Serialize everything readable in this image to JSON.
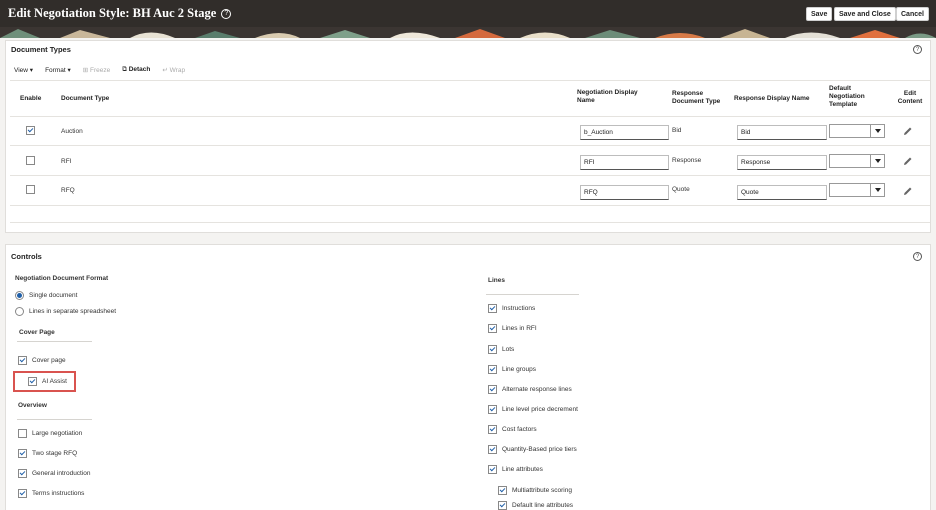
{
  "header": {
    "title": "Edit Negotiation Style: BH Auc 2 Stage",
    "help_icon": "?",
    "save": "Save",
    "save_close": "Save and Close",
    "cancel": "Cancel"
  },
  "doc_types": {
    "title": "Document Types",
    "toolbar": {
      "view": "View",
      "format": "Format",
      "freeze": "Freeze",
      "detach": "Detach",
      "wrap": "Wrap"
    },
    "headers": {
      "enable": "Enable",
      "doc_type": "Document Type",
      "neg_display": "Negotiation Display Name",
      "resp_doc_type": "Response Document Type",
      "resp_display": "Response Display Name",
      "default_template": "Default Negotiation Template",
      "edit_content": "Edit Content"
    },
    "rows": [
      {
        "enabled": true,
        "type": "Auction",
        "neg_name": "b_Auction",
        "resp_type": "Bid",
        "resp_name": "Bid"
      },
      {
        "enabled": false,
        "type": "RFI",
        "neg_name": "RFI",
        "resp_type": "Response",
        "resp_name": "Response"
      },
      {
        "enabled": false,
        "type": "RFQ",
        "neg_name": "RFQ",
        "resp_type": "Quote",
        "resp_name": "Quote"
      }
    ]
  },
  "controls": {
    "title": "Controls",
    "format_label": "Negotiation Document Format",
    "formats": [
      {
        "label": "Single document",
        "selected": true
      },
      {
        "label": "Lines in separate spreadsheet",
        "selected": false
      }
    ],
    "cover_label": "Cover Page",
    "cover_items": [
      {
        "label": "Cover page",
        "checked": true
      },
      {
        "label": "AI Assist",
        "checked": true
      }
    ],
    "overview_label": "Overview",
    "overview_items": [
      {
        "label": "Large negotiation",
        "checked": false
      },
      {
        "label": "Two stage RFQ",
        "checked": true
      },
      {
        "label": "General introduction",
        "checked": true
      },
      {
        "label": "Terms instructions",
        "checked": true
      }
    ],
    "lines_label": "Lines",
    "lines_items": [
      {
        "label": "Instructions",
        "checked": true
      },
      {
        "label": "Lines in RFI",
        "checked": true
      },
      {
        "label": "Lots",
        "checked": true
      },
      {
        "label": "Line groups",
        "checked": true
      },
      {
        "label": "Alternate response lines",
        "checked": true
      },
      {
        "label": "Line level price decrement",
        "checked": true
      },
      {
        "label": "Cost factors",
        "checked": true
      },
      {
        "label": "Quantity-Based price tiers",
        "checked": true
      },
      {
        "label": "Line attributes",
        "checked": true
      },
      {
        "label": "Multiattribute scoring",
        "checked": true
      },
      {
        "label": "Default line attributes",
        "checked": true
      }
    ]
  },
  "icons": {
    "help": "question-circle-icon",
    "edit": "pencil-icon",
    "dropdown": "chevron-down-icon",
    "freeze": "freeze-icon",
    "wrap": "wrap-icon"
  },
  "colors": {
    "header_bg": "#312d2a",
    "accent": "#1f5fa8",
    "highlight": "#d9534f"
  }
}
